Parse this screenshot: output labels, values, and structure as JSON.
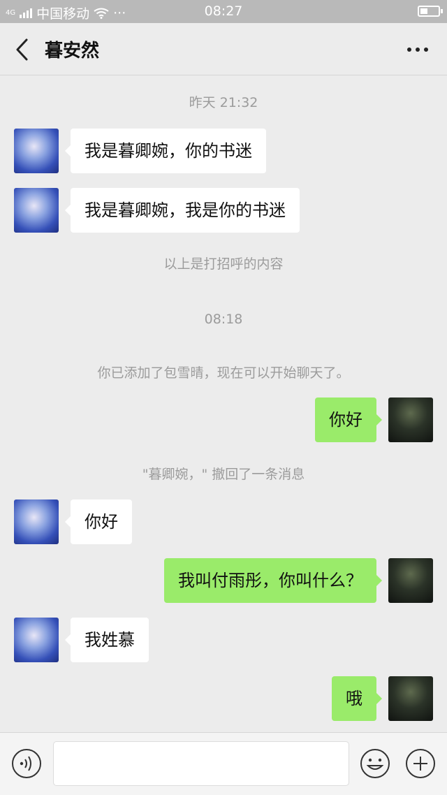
{
  "status_bar": {
    "network": "4G",
    "carrier": "中国移动",
    "extra": "···",
    "time": "08:27"
  },
  "header": {
    "back_icon": "chevron-left-icon",
    "title": "暮安然",
    "more_icon": "more-dots-icon"
  },
  "messages": [
    {
      "type": "system",
      "text": "昨天 21:32"
    },
    {
      "type": "incoming",
      "text": "我是暮卿婉，你的书迷"
    },
    {
      "type": "incoming",
      "text": "我是暮卿婉，我是你的书迷"
    },
    {
      "type": "system",
      "text": "以上是打招呼的内容"
    },
    {
      "type": "system",
      "text": "08:18"
    },
    {
      "type": "system",
      "text": "你已添加了包雪晴，现在可以开始聊天了。"
    },
    {
      "type": "outgoing",
      "text": "你好"
    },
    {
      "type": "system",
      "text": "\"暮卿婉，\" 撤回了一条消息"
    },
    {
      "type": "incoming",
      "text": "你好"
    },
    {
      "type": "outgoing",
      "text": "我叫付雨彤，你叫什么？"
    },
    {
      "type": "incoming",
      "text": "我姓慕"
    },
    {
      "type": "outgoing",
      "text": "哦"
    }
  ],
  "input_bar": {
    "voice_icon": "voice-icon",
    "input_value": "",
    "emoji_icon": "emoji-icon",
    "plus_icon": "plus-icon"
  },
  "colors": {
    "background": "#ececec",
    "outgoing_bubble": "#9aeb6a",
    "incoming_bubble": "#ffffff",
    "system_text": "#9b9b9b"
  }
}
